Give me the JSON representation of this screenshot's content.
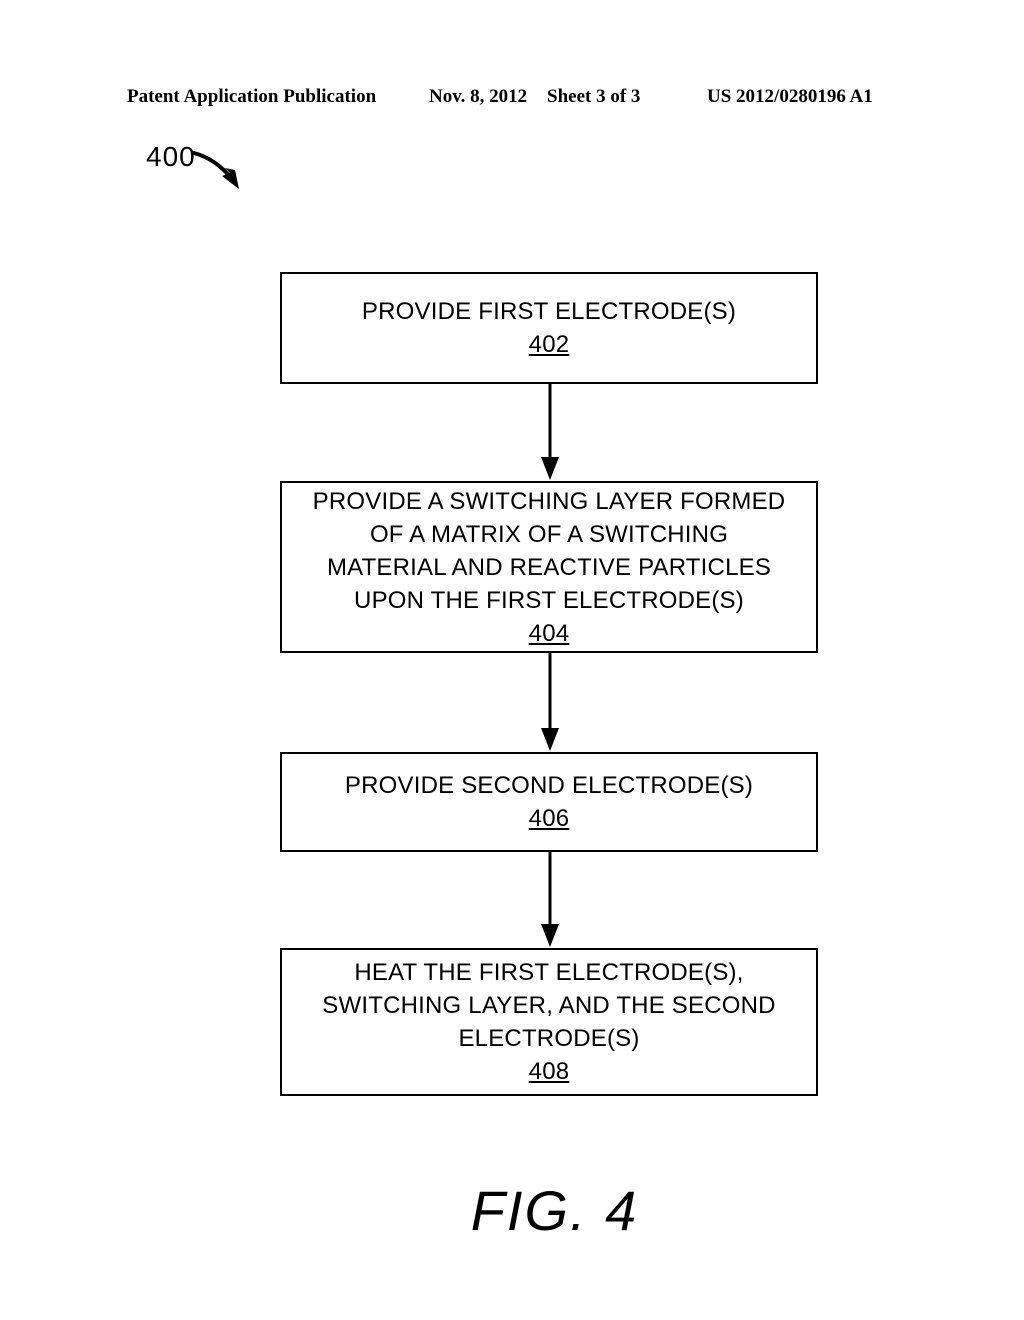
{
  "header": {
    "publication": "Patent Application Publication",
    "date": "Nov. 8, 2012",
    "sheet": "Sheet 3 of 3",
    "patent_number": "US 2012/0280196 A1"
  },
  "figure": {
    "reference_numeral": "400",
    "caption": "FIG. 4",
    "lead_arrow_icon": "curved-arrow-icon"
  },
  "flowchart": {
    "arrow_icon": "down-arrow-icon",
    "steps": [
      {
        "id": "402",
        "lines": [
          "PROVIDE FIRST ELECTRODE(S)"
        ],
        "ref": "402"
      },
      {
        "id": "404",
        "lines": [
          "PROVIDE A SWITCHING LAYER FORMED",
          "OF A MATRIX OF A SWITCHING",
          "MATERIAL AND REACTIVE PARTICLES",
          "UPON THE FIRST ELECTRODE(S)"
        ],
        "ref": "404"
      },
      {
        "id": "406",
        "lines": [
          "PROVIDE SECOND ELECTRODE(S)"
        ],
        "ref": "406"
      },
      {
        "id": "408",
        "lines": [
          "HEAT THE FIRST ELECTRODE(S),",
          "SWITCHING LAYER, AND THE SECOND",
          "ELECTRODE(S)"
        ],
        "ref": "408"
      }
    ]
  },
  "colors": {
    "ink": "#000000",
    "page": "#ffffff"
  }
}
